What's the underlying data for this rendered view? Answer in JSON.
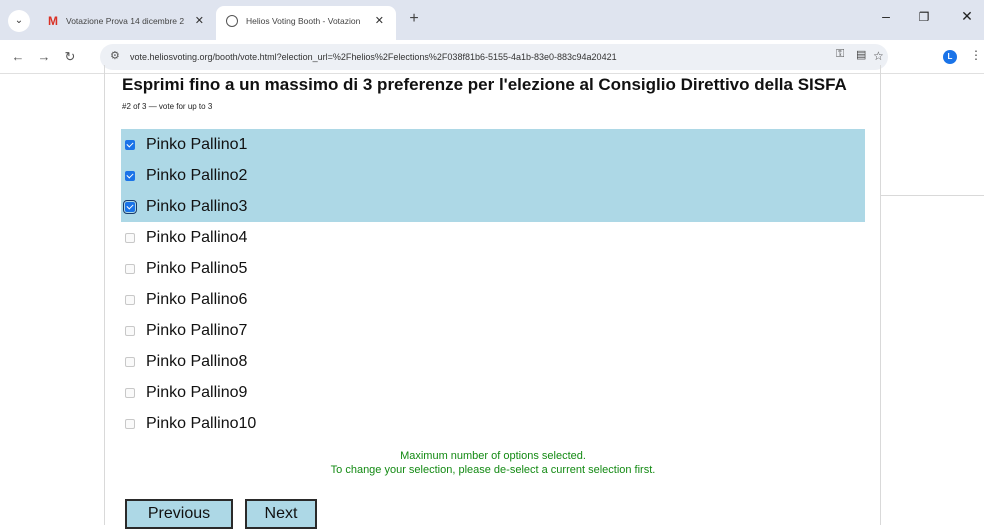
{
  "browser": {
    "tabs": [
      {
        "title": "Votazione Prova 14 dicembre 2",
        "icon": "gmail-icon",
        "active": false
      },
      {
        "title": "Helios Voting Booth - Votazion",
        "icon": "globe-icon",
        "active": true
      }
    ],
    "url": "vote.heliosvoting.org/booth/vote.html?election_url=%2Fhelios%2Felections%2F038f81b6-5155-4a1b-83e0-883c94a20421",
    "profile_initial": "L"
  },
  "question": {
    "title": "Esprimi fino a un massimo di 3 preferenze per l'elezione al Consiglio Direttivo della SISFA",
    "subtitle": "#2 of 3 — vote for up to 3"
  },
  "answers": [
    {
      "label": "Pinko Pallino1",
      "checked": true
    },
    {
      "label": "Pinko Pallino2",
      "checked": true
    },
    {
      "label": "Pinko Pallino3",
      "checked": true
    },
    {
      "label": "Pinko Pallino4",
      "checked": false
    },
    {
      "label": "Pinko Pallino5",
      "checked": false
    },
    {
      "label": "Pinko Pallino6",
      "checked": false
    },
    {
      "label": "Pinko Pallino7",
      "checked": false
    },
    {
      "label": "Pinko Pallino8",
      "checked": false
    },
    {
      "label": "Pinko Pallino9",
      "checked": false
    },
    {
      "label": "Pinko Pallino10",
      "checked": false
    }
  ],
  "warning": {
    "line1": "Maximum number of options selected.",
    "line2": "To change your selection, please de-select a current selection first."
  },
  "buttons": {
    "previous": "Previous",
    "next": "Next"
  },
  "colors": {
    "selected_row": "#add8e6",
    "warning_text": "#138a13",
    "checkbox_checked": "#1a73e8"
  }
}
